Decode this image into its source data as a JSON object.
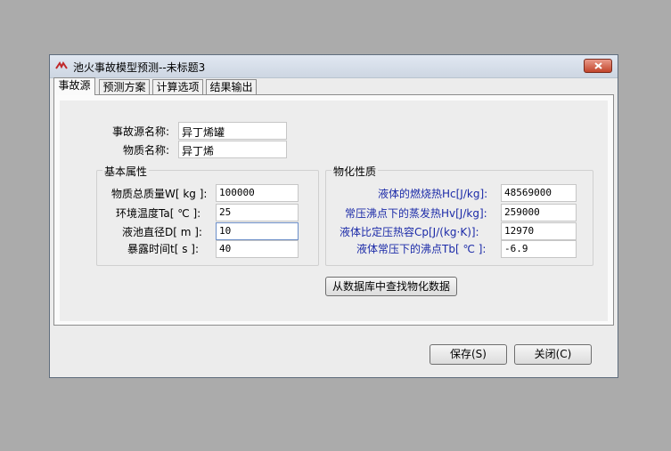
{
  "window": {
    "title": "池火事故模型预测--未标题3"
  },
  "tabs": [
    "事故源",
    "预测方案",
    "计算选项",
    "结果输出"
  ],
  "source": {
    "name_label": "事故源名称:",
    "name_value": "异丁烯罐",
    "material_label": "物质名称:",
    "material_value": "异丁烯"
  },
  "basic": {
    "title": "基本属性",
    "rows": [
      {
        "label": "物质总质量W[ kg ]:",
        "value": "100000"
      },
      {
        "label": "环境温度Ta[ ℃ ]:",
        "value": "25"
      },
      {
        "label": "液池直径D[  m ]:",
        "value": "10"
      },
      {
        "label": "暴露时间t[ s ]:",
        "value": "40"
      }
    ]
  },
  "physchem": {
    "title": "物化性质",
    "rows": [
      {
        "label": "液体的燃烧热Hc[J/kg]:",
        "value": "48569000"
      },
      {
        "label": "常压沸点下的蒸发热Hv[J/kg]:",
        "value": "259000"
      },
      {
        "label": "液体比定压热容Cp[J/(kg·K)]:",
        "value": "12970"
      },
      {
        "label": "液体常压下的沸点Tb[ ℃ ]:",
        "value": "-6.9"
      }
    ],
    "lookup_button": "从数据库中查找物化数据"
  },
  "buttons": {
    "save": "保存(S)",
    "close": "关闭(C)"
  },
  "colors": {
    "blue_label": "#1b2aa8",
    "close_btn": "#c2452b"
  }
}
